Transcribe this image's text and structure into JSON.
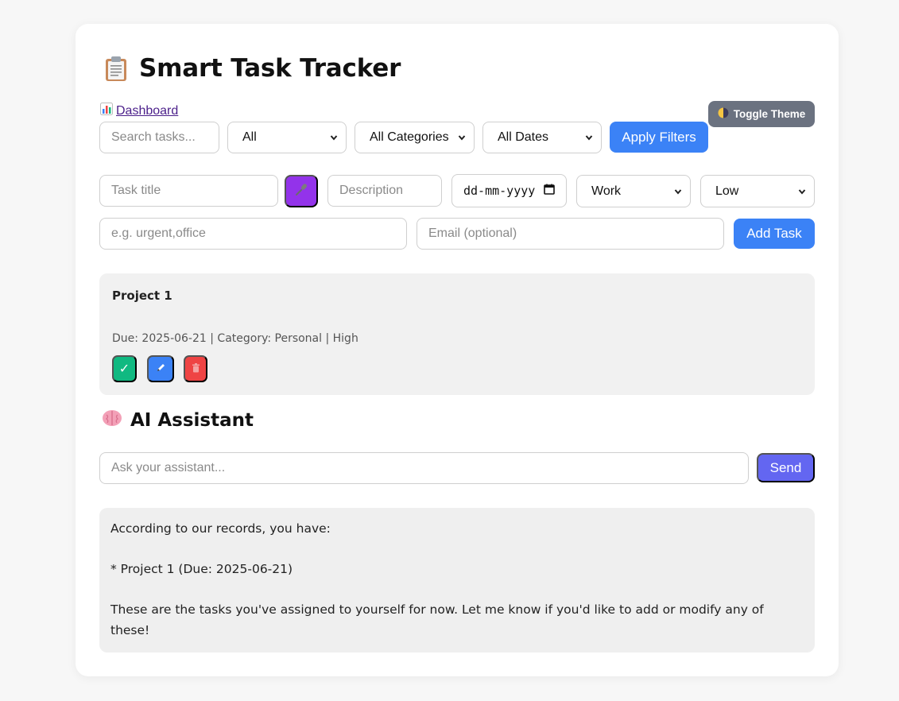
{
  "app": {
    "title": "Smart Task Tracker",
    "title_icon": "clipboard-icon"
  },
  "nav": {
    "dashboard_label": "Dashboard",
    "dashboard_icon": "bar-chart-icon"
  },
  "theme_button": {
    "label": "Toggle Theme",
    "icon": "half-moon-icon"
  },
  "filters": {
    "search_placeholder": "Search tasks...",
    "status_value": "All",
    "category_value": "All Categories",
    "date_value": "All Dates",
    "apply_label": "Apply Filters"
  },
  "task_form": {
    "title_placeholder": "Task title",
    "mic_icon": "microphone-icon",
    "description_placeholder": "Description",
    "date_placeholder": "dd-mm-yyyy",
    "category_value": "Work",
    "priority_value": "Low",
    "tags_placeholder": "e.g. urgent,office",
    "email_placeholder": "Email (optional)",
    "add_label": "Add Task"
  },
  "tasks": [
    {
      "title": "Project 1",
      "meta": "Due: 2025-06-21 | Category: Personal | High",
      "complete_icon": "✓",
      "edit_icon": "pencil-icon",
      "delete_icon": "trash-icon"
    }
  ],
  "assistant": {
    "title": "AI Assistant",
    "icon": "brain-icon",
    "input_placeholder": "Ask your assistant...",
    "send_label": "Send",
    "response_lines": [
      "According to our records, you have:",
      "* Project 1 (Due: 2025-06-21)",
      "These are the tasks you've assigned to yourself for now. Let me know if you'd like to add or modify any of these!"
    ]
  },
  "colors": {
    "primary": "#3b82f6",
    "mic": "#9333ea",
    "complete": "#10b981",
    "delete": "#ef4444",
    "send": "#6366f1",
    "theme_button": "#6b7280"
  }
}
